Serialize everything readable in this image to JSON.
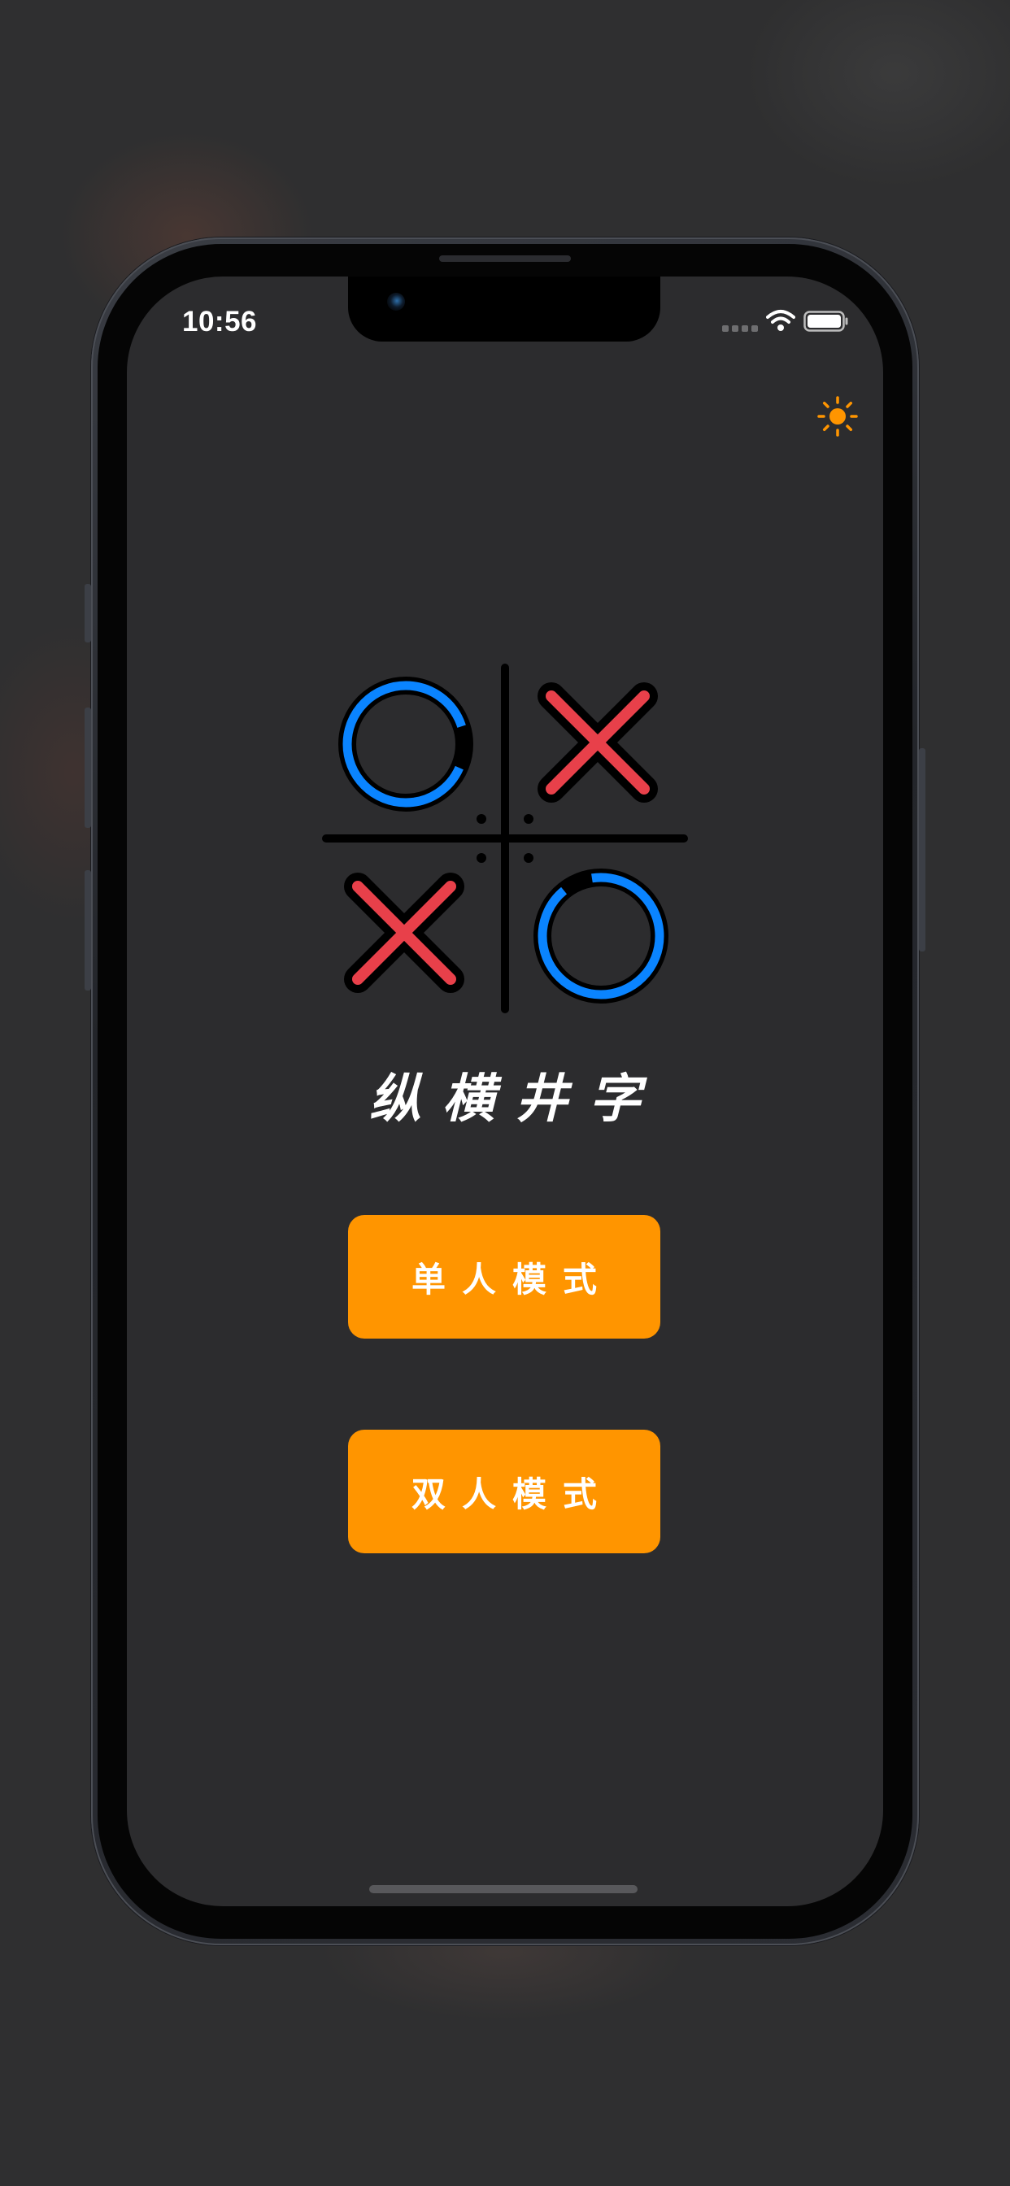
{
  "status_bar": {
    "time": "10:56",
    "icons": [
      "signal-icon",
      "wifi-icon",
      "battery-icon"
    ]
  },
  "toolbar": {
    "theme_toggle_icon": "sun-icon",
    "accent_color": "#ff9500"
  },
  "logo": {
    "icon": "tic-tac-toe-logo-icon",
    "o_color": "#0a84ff",
    "x_color": "#e8404a"
  },
  "title": "纵横井字",
  "buttons": {
    "single_mode_label": "单人模式",
    "two_player_label": "双人模式",
    "color": "#ff9500"
  },
  "theme": {
    "background": "#2c2c2e"
  }
}
